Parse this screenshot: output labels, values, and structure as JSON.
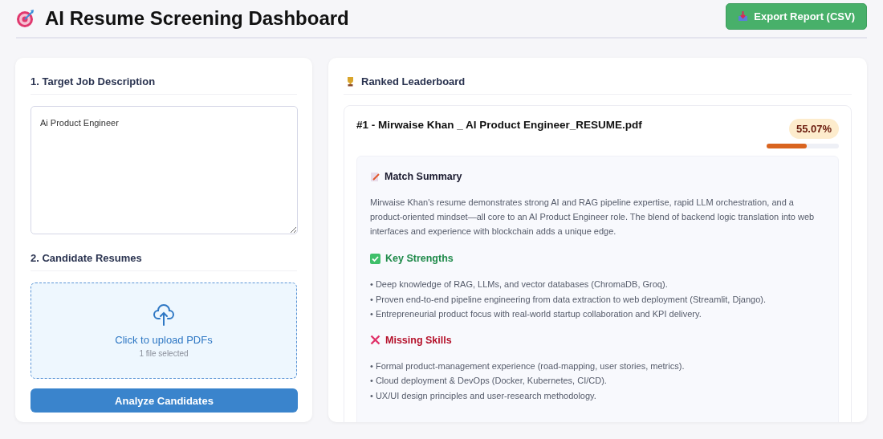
{
  "header": {
    "title": "AI Resume Screening Dashboard",
    "export_button": "Export Report (CSV)"
  },
  "inputs": {
    "job_heading": "1. Target Job Description",
    "job_description": "Ai Product Engineer",
    "resumes_heading": "2. Candidate Resumes",
    "upload_label": "Click to upload PDFs",
    "upload_status": "1 file selected",
    "analyze_button": "Analyze Candidates"
  },
  "leaderboard": {
    "title": "Ranked Leaderboard",
    "candidates": [
      {
        "rank_title": "#1 - Mirwaise Khan _ AI Product Engineer_RESUME.pdf",
        "score": "55.07%",
        "level": 0.55,
        "sections": [
          {
            "kind": "summary",
            "heading": "Match Summary",
            "text": "Mirwaise Khan's resume demonstrates strong AI and RAG pipeline expertise, rapid LLM orchestration, and a product-oriented mindset—all core to an AI Product Engineer role. The blend of backend logic translation into web interfaces and experience with blockchain adds a unique edge."
          },
          {
            "kind": "strengths",
            "heading": "Key Strengths",
            "items": [
              "• Deep knowledge of RAG, LLMs, and vector databases (ChromaDB, Groq).",
              "• Proven end-to-end pipeline engineering from data extraction to web deployment (Streamlit, Django).",
              "• Entrepreneurial product focus with real-world startup collaboration and KPI delivery."
            ]
          },
          {
            "kind": "missing",
            "heading": "Missing Skills",
            "items": [
              "• Formal product-management experience (road-mapping, user stories, metrics).",
              "• Cloud deployment & DevOps (Docker, Kubernetes, CI/CD).",
              "• UX/UI design principles and user-research methodology."
            ]
          }
        ]
      }
    ]
  }
}
